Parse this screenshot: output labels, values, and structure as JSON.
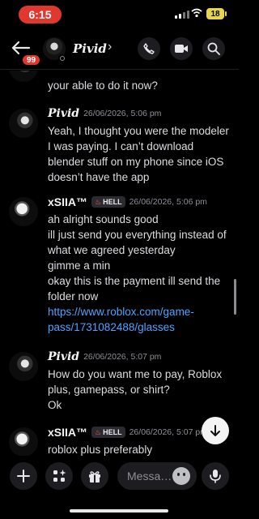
{
  "status_bar": {
    "time": "6:15",
    "battery": "18"
  },
  "header": {
    "unread_count": "99",
    "contact_name": "Pivid",
    "chevron": "›"
  },
  "messages": {
    "cut_off_text": "your able to do it now?",
    "groups": [
      {
        "user": "Pivid",
        "timestamp": "26/06/2026, 5:06 pm",
        "lines": [
          "Yeah, I thought you were the modeler I was paying. I can’t download blender stuff on my phone since iOS doesn’t have the app"
        ]
      },
      {
        "user": "xSIIA™",
        "tag": "HELL",
        "timestamp": "26/06/2026, 5:06 pm",
        "lines": [
          "ah alright sounds good",
          "ill just send you everything instead of what we agreed yesterday",
          "gimme a min",
          "okay this is the payment ill send the folder now"
        ],
        "link": "https://www.roblox.com/game-pass/1731082488/glasses"
      },
      {
        "user": "Pivid",
        "timestamp": "26/06/2026, 5:07 pm",
        "lines": [
          "How do you want me to pay, Roblox plus, gamepass, or shirt?",
          "Ok"
        ]
      },
      {
        "user": "xSIIA™",
        "tag": "HELL",
        "timestamp": "26/06/2026, 5:07 pm",
        "lines": [
          "roblox plus preferably"
        ]
      }
    ]
  },
  "composer": {
    "placeholder": "Messa…"
  },
  "icons": {
    "back": "arrow-left-icon",
    "call": "phone-icon",
    "video": "video-camera-icon",
    "search": "search-icon",
    "add": "plus-icon",
    "apps": "apps-sparkle-icon",
    "gift": "gift-icon",
    "emoji": "emoji-icon",
    "mic": "microphone-icon",
    "jump": "arrow-down-icon"
  },
  "colors": {
    "accent_link": "#4ea3ff",
    "badge_red": "#e0372f",
    "battery_yellow": "#e8d64a",
    "background": "#000000"
  }
}
